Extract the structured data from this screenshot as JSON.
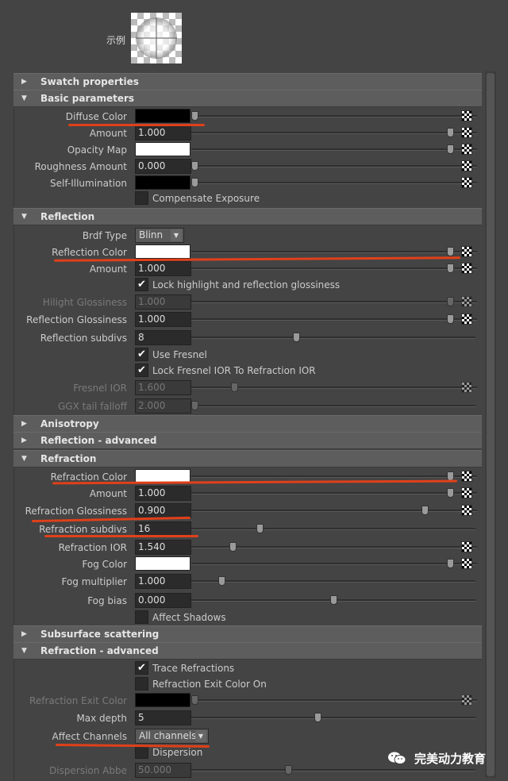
{
  "swatch_label": "示例",
  "sections": {
    "swatch": "Swatch properties",
    "basic": "Basic parameters",
    "reflection": "Reflection",
    "anisotropy": "Anisotropy",
    "reflection_adv": "Reflection - advanced",
    "refraction": "Refraction",
    "sss": "Subsurface scattering",
    "refraction_adv": "Refraction - advanced"
  },
  "basic": {
    "diffuse_color": "Diffuse Color",
    "amount": "Amount",
    "amount_val": "1.000",
    "opacity_map": "Opacity Map",
    "roughness": "Roughness Amount",
    "roughness_val": "0.000",
    "self_illum": "Self-Illumination",
    "compensate": "Compensate Exposure"
  },
  "reflection": {
    "brdf_type": "Brdf Type",
    "brdf_val": "Blinn",
    "color": "Reflection Color",
    "amount": "Amount",
    "amount_val": "1.000",
    "lock_hl": "Lock highlight and reflection glossiness",
    "hilight": "Hilight Glossiness",
    "hilight_val": "1.000",
    "gloss": "Reflection Glossiness",
    "gloss_val": "1.000",
    "subdivs": "Reflection subdivs",
    "subdivs_val": "8",
    "use_fresnel": "Use Fresnel",
    "lock_fresnel": "Lock Fresnel IOR To Refraction IOR",
    "fresnel_ior": "Fresnel IOR",
    "fresnel_ior_val": "1.600",
    "ggx": "GGX tail falloff",
    "ggx_val": "2.000"
  },
  "refraction": {
    "color": "Refraction Color",
    "amount": "Amount",
    "amount_val": "1.000",
    "gloss": "Refraction Glossiness",
    "gloss_val": "0.900",
    "subdivs": "Refraction subdivs",
    "subdivs_val": "16",
    "ior": "Refraction IOR",
    "ior_val": "1.540",
    "fog_color": "Fog Color",
    "fog_mult": "Fog multiplier",
    "fog_mult_val": "1.000",
    "fog_bias": "Fog bias",
    "fog_bias_val": "0.000",
    "affect_shadows": "Affect Shadows"
  },
  "refraction_adv": {
    "trace": "Trace Refractions",
    "exit_on": "Refraction Exit Color On",
    "exit_color": "Refraction Exit Color",
    "max_depth": "Max depth",
    "max_depth_val": "5",
    "affect_channels": "Affect Channels",
    "affect_channels_val": "All channels",
    "dispersion": "Dispersion",
    "disp_abbe": "Dispersion Abbe",
    "disp_abbe_val": "50.000"
  },
  "watermark": "完美动力教育",
  "colors": {
    "accent_underline": "#e0401a",
    "panel_bg": "#444444",
    "header_bg": "#5d5d5d"
  }
}
